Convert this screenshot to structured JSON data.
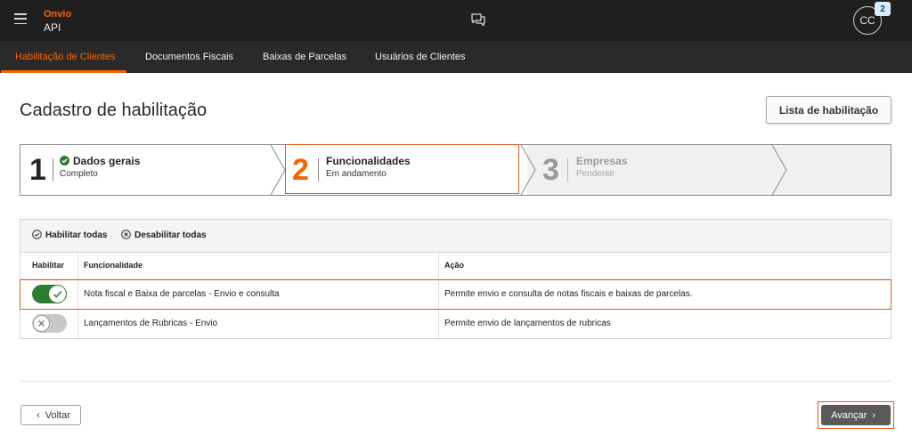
{
  "header": {
    "brand": "Onvio",
    "product": "API",
    "chat_icon": "chat-bubbles-icon",
    "avatar_initials": "CC",
    "notification_count": "2"
  },
  "tabs": [
    {
      "label": "Habilitação de Clientes",
      "active": true
    },
    {
      "label": "Documentos Fiscais",
      "active": false
    },
    {
      "label": "Baixas de Parcelas",
      "active": false
    },
    {
      "label": "Usuários de Clientes",
      "active": false
    }
  ],
  "page": {
    "title": "Cadastro de habilitação",
    "list_button": "Lista de habilitação"
  },
  "stepper": {
    "steps": [
      {
        "number": "1",
        "title": "Dados gerais",
        "status": "Completo",
        "state": "complete"
      },
      {
        "number": "2",
        "title": "Funcionalidades",
        "status": "Em andamento",
        "state": "current"
      },
      {
        "number": "3",
        "title": "Empresas",
        "status": "Pendente",
        "state": "pending"
      }
    ]
  },
  "table": {
    "enable_all": "Habilitar todas",
    "disable_all": "Desabilitar todas",
    "columns": [
      "Habilitar",
      "Funcionalidade",
      "Ação"
    ],
    "rows": [
      {
        "enabled": true,
        "feature": "Nota fiscal e Baixa de parcelas - Envio e consulta",
        "action": "Permite envio e consulta de notas fiscais e baixas de parcelas."
      },
      {
        "enabled": false,
        "feature": "Lançamentos de Rubricas - Envio",
        "action": "Permite envio de lançamentos de rubricas"
      }
    ]
  },
  "footer": {
    "back": "Voltar",
    "next": "Avançar"
  },
  "colors": {
    "accent": "#fa6400",
    "highlight": "#e35b1b",
    "toggle_on": "#2d7d32",
    "success": "#2e7d32"
  }
}
